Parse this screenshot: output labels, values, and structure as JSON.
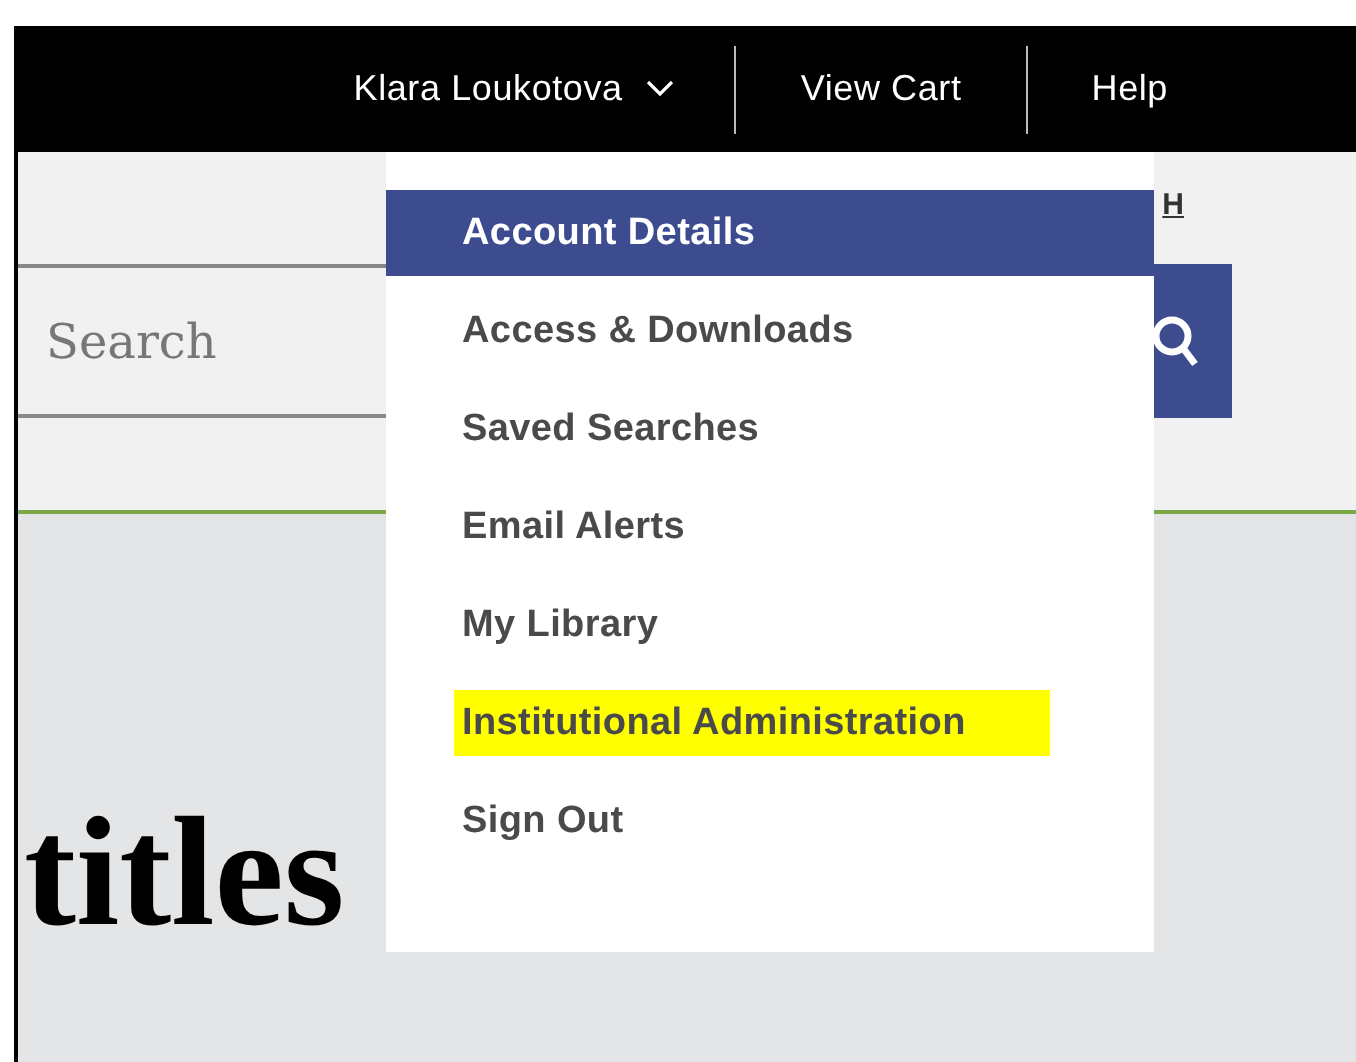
{
  "top_bar": {
    "user_name": "Klara Loukotova",
    "links": [
      "View Cart",
      "Help"
    ]
  },
  "header": {
    "link_fragment": "H",
    "search": {
      "placeholder": "Search"
    }
  },
  "account_menu": {
    "expanded": true,
    "items": [
      {
        "label": "Account Details",
        "selected": true,
        "highlighted": false
      },
      {
        "label": "Access & Downloads",
        "selected": false,
        "highlighted": false
      },
      {
        "label": "Saved Searches",
        "selected": false,
        "highlighted": false
      },
      {
        "label": "Email Alerts",
        "selected": false,
        "highlighted": false
      },
      {
        "label": "My Library",
        "selected": false,
        "highlighted": false
      },
      {
        "label": "Institutional Administration",
        "selected": false,
        "highlighted": true
      },
      {
        "label": "Sign Out",
        "selected": false,
        "highlighted": false
      }
    ]
  },
  "content": {
    "heading": "titles"
  }
}
